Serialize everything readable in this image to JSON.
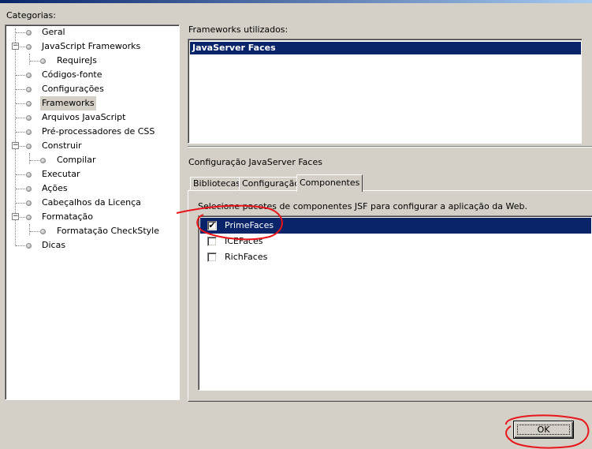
{
  "categories_label": "Categorias:",
  "tree": [
    {
      "label": "Geral",
      "icon": "bullet-icon"
    },
    {
      "label": "JavaScript Frameworks",
      "icon": "bullet-icon",
      "expander": "−"
    },
    {
      "label": "RequireJs",
      "icon": "bullet-icon"
    },
    {
      "label": "Códigos-fonte",
      "icon": "bullet-icon"
    },
    {
      "label": "Configurações",
      "icon": "bullet-icon"
    },
    {
      "label": "Frameworks",
      "icon": "bullet-icon",
      "selected": true
    },
    {
      "label": "Arquivos JavaScript",
      "icon": "bullet-icon"
    },
    {
      "label": "Pré-processadores de CSS",
      "icon": "bullet-icon"
    },
    {
      "label": "Construir",
      "icon": "bullet-icon",
      "expander": "−"
    },
    {
      "label": "Compilar",
      "icon": "bullet-icon"
    },
    {
      "label": "Executar",
      "icon": "bullet-icon"
    },
    {
      "label": "Ações",
      "icon": "bullet-icon"
    },
    {
      "label": "Cabeçalhos da Licença",
      "icon": "bullet-icon"
    },
    {
      "label": "Formatação",
      "icon": "bullet-icon",
      "expander": "−"
    },
    {
      "label": "Formatação CheckStyle",
      "icon": "bullet-icon"
    },
    {
      "label": "Dicas",
      "icon": "bullet-icon"
    }
  ],
  "frameworks_label": "Frameworks utilizados:",
  "frameworks": [
    "JavaServer Faces"
  ],
  "config_label": "Configuração JavaServer Faces",
  "tabs": [
    {
      "label": "Bibliotecas",
      "active": false
    },
    {
      "label": "Configuração",
      "active": false
    },
    {
      "label": "Componentes",
      "active": true
    }
  ],
  "components_desc": "Selecione pacotes de componentes JSF para configurar a aplicação da Web.",
  "components": [
    {
      "label": "PrimeFaces",
      "checked": true,
      "selected": true
    },
    {
      "label": "ICEFaces",
      "checked": false,
      "selected": false
    },
    {
      "label": "RichFaces",
      "checked": false,
      "selected": false
    }
  ],
  "ok_label": "OK",
  "colors": {
    "selection": "#0a246a",
    "window_bg": "#d4d0c8",
    "annotation": "#e8151b"
  }
}
